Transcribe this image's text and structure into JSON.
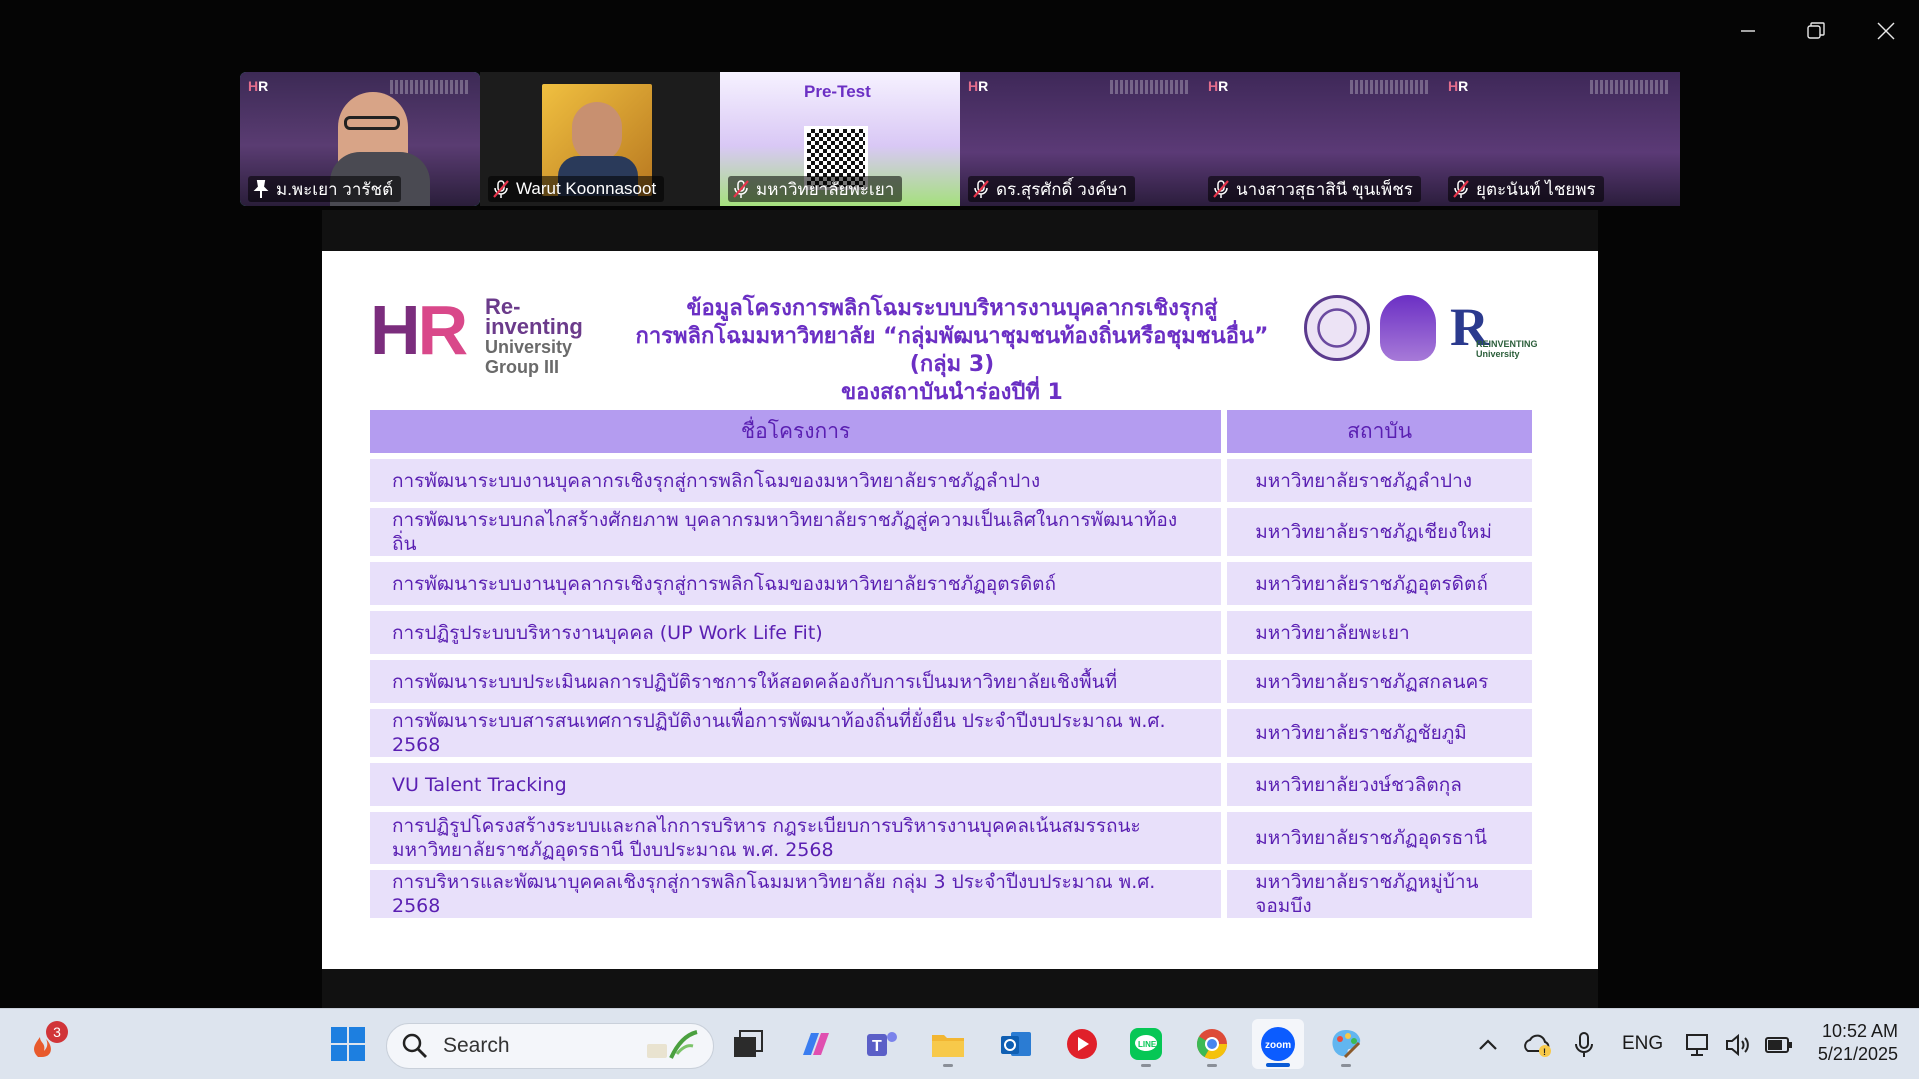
{
  "participants": [
    {
      "name": "ม.พะเยา วารัชต์",
      "pinned": true,
      "active": true,
      "kind": "video"
    },
    {
      "name": "Warut Koonnasoot",
      "pinned": false,
      "active": false,
      "kind": "photo"
    },
    {
      "name": "มหาวิทยาลัยพะเยา",
      "pinned": false,
      "active": false,
      "kind": "pretest",
      "overlay_title": "Pre-Test"
    },
    {
      "name": "ดร.สุรศักดิ์ วงค์ษา",
      "pinned": false,
      "active": false,
      "kind": "banner"
    },
    {
      "name": "นางสาวสุธาสินี ขุนเพ็ชร",
      "pinned": false,
      "active": false,
      "kind": "banner"
    },
    {
      "name": "ยุตะนันท์ ไชยพร",
      "pinned": false,
      "active": false,
      "kind": "banner"
    }
  ],
  "slide": {
    "logo": {
      "mark": "HR",
      "line1": "Re-inventing",
      "line2": "University",
      "line3": "Group III"
    },
    "title_lines": [
      "ข้อมูลโครงการพลิกโฉมระบบบริหารงานบุคลากรเชิงรุกสู่",
      "การพลิกโฉมมหาวิทยาลัย “กลุ่มพัฒนาชุมชนท้องถิ่นหรือชุมชนอื่น” (กลุ่ม 3)",
      "ของสถาบันนำร่องปีที่ 1"
    ],
    "seal3_text": "REINVENTING University",
    "table": {
      "headers": [
        "ชื่อโครงการ",
        "สถาบัน"
      ],
      "rows": [
        [
          "การพัฒนาระบบงานบุคลากรเชิงรุกสู่การพลิกโฉมของมหาวิทยาลัยราชภัฏลำปาง",
          "มหาวิทยาลัยราชภัฏลำปาง"
        ],
        [
          "การพัฒนาระบบกลไกสร้างศักยภาพ บุคลากรมหาวิทยาลัยราชภัฏสู่ความเป็นเลิศในการพัฒนาท้องถิ่น",
          "มหาวิทยาลัยราชภัฏเชียงใหม่"
        ],
        [
          "การพัฒนาระบบงานบุคลากรเชิงรุกสู่การพลิกโฉมของมหาวิทยาลัยราชภัฏอุตรดิตถ์",
          "มหาวิทยาลัยราชภัฏอุตรดิตถ์"
        ],
        [
          "การปฏิรูประบบบริหารงานบุคคล (UP Work Life Fit)",
          "มหาวิทยาลัยพะเยา"
        ],
        [
          "การพัฒนาระบบประเมินผลการปฏิบัติราชการให้สอดคล้องกับการเป็นมหาวิทยาลัยเชิงพื้นที่",
          "มหาวิทยาลัยราชภัฏสกลนคร"
        ],
        [
          "การพัฒนาระบบสารสนเทศการปฏิบัติงานเพื่อการพัฒนาท้องถิ่นที่ยั่งยืน ประจำปีงบประมาณ พ.ศ. 2568",
          "มหาวิทยาลัยราชภัฏชัยภูมิ"
        ],
        [
          "VU Talent Tracking",
          "มหาวิทยาลัยวงษ์ชวลิตกุล"
        ],
        [
          "การปฏิรูปโครงสร้างระบบและกลไกการบริหาร กฎระเบียบการบริหารงานบุคคลเน้นสมรรถนะ มหาวิทยาลัยราชภัฏอุดรธานี ปีงบประมาณ พ.ศ. 2568",
          "มหาวิทยาลัยราชภัฏอุดรธานี"
        ],
        [
          "การบริหารและพัฒนาบุคคลเชิงรุกสู่การพลิกโฉมมหาวิทยาลัย กลุ่ม 3 ประจำปีงบประมาณ พ.ศ. 2568",
          "มหาวิทยาลัยราชภัฏหมู่บ้านจอมบึง"
        ]
      ]
    }
  },
  "taskbar": {
    "notification_count": "3",
    "search_label": "Search",
    "apps": [
      "start",
      "task-view",
      "copilot",
      "teams",
      "file-explorer",
      "outlook",
      "media-player",
      "line",
      "chrome",
      "zoom",
      "paint"
    ],
    "tray": {
      "language": "ENG",
      "time": "10:52 AM",
      "date": "5/21/2025"
    }
  },
  "colors": {
    "accent": "#2fd6a0",
    "slide_header": "#b49cf0",
    "slide_text": "#5a1fb2",
    "slide_row": "#e8e0fa",
    "zoom_blue": "#0b5cff"
  }
}
